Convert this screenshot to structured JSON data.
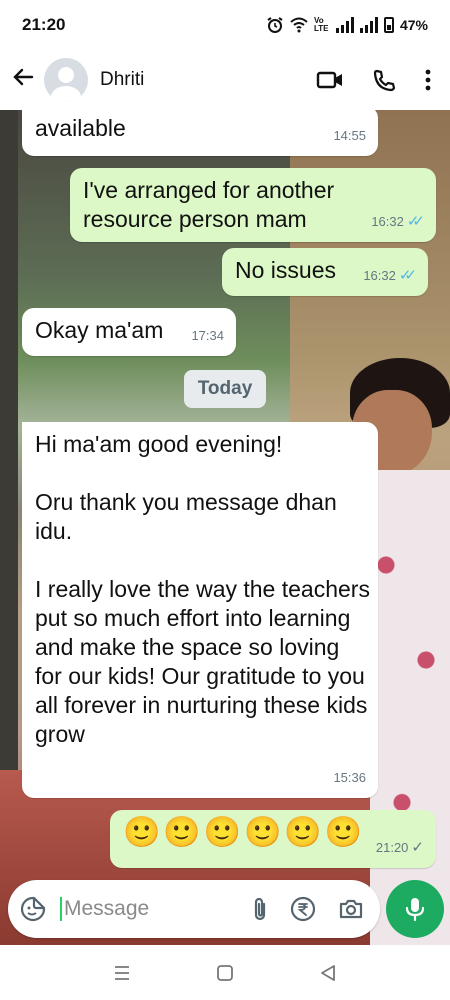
{
  "status_bar": {
    "time": "21:20",
    "network_label": "Vo LTE",
    "battery": "47%"
  },
  "header": {
    "contact_name": "Dhriti"
  },
  "messages": [
    {
      "direction": "in",
      "text": "available",
      "time": "14:55"
    },
    {
      "direction": "out",
      "text": "I've arranged for another resource person mam",
      "time": "16:32",
      "status": "read"
    },
    {
      "direction": "out",
      "text": "No issues",
      "time": "16:32",
      "status": "read"
    },
    {
      "direction": "in",
      "text": "Okay ma'am",
      "time": "17:34"
    },
    {
      "direction": "in",
      "text": "Hi ma'am good evening!\n\nOru thank you message dhan idu.\n\nI really love the way the teachers put so much effort into learning and make the space so loving for our kids! Our gratitude to you all forever in nurturing these kids grow",
      "time": "15:36"
    },
    {
      "direction": "out",
      "text": "🙂🙂🙂🙂🙂🙂",
      "time": "21:20",
      "status": "sent"
    }
  ],
  "date_divider": "Today",
  "composer": {
    "placeholder": "Message"
  },
  "icons": {
    "back": "back-arrow-icon",
    "video": "video-call-icon",
    "call": "phone-call-icon",
    "menu": "more-vertical-icon",
    "sticker": "sticker-icon",
    "attach": "paperclip-icon",
    "payment": "rupee-icon",
    "camera": "camera-icon",
    "mic": "mic-icon"
  },
  "colors": {
    "outgoing_bubble": "#dcf8c6",
    "incoming_bubble": "#ffffff",
    "read_ticks": "#4fb6ec",
    "mic_button": "#1daa61"
  }
}
